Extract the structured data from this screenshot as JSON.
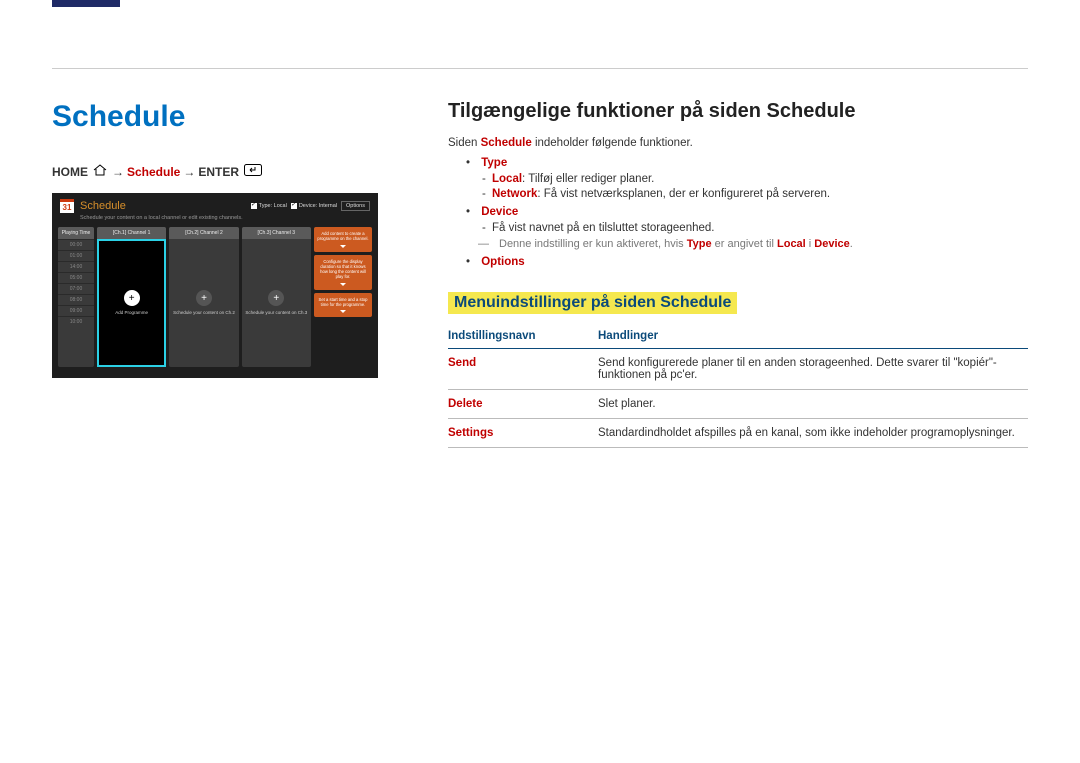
{
  "left": {
    "title": "Schedule",
    "breadcrumb": {
      "home": "HOME",
      "arrow": "→",
      "schedule": "Schedule",
      "enter": "ENTER"
    },
    "mock": {
      "calendar_day": "31",
      "title": "Schedule",
      "top_type": "Type: Local",
      "top_device": "Device: Internal",
      "top_options": "Options",
      "subtitle": "Schedule your content on a local channel or edit existing channels.",
      "times_header": "Playing Time",
      "times": [
        "00:00",
        "01:00",
        "14:00",
        "05:00",
        "07:00",
        "08:00",
        "09:00",
        "10:00"
      ],
      "ch1": {
        "header": "[Ch.1] Channel 1",
        "label": "Add Programme"
      },
      "ch2": {
        "header": "[Ch.2] Channel 2",
        "label": "Schedule your content on Ch.2"
      },
      "ch3": {
        "header": "[Ch.3] Channel 3",
        "label": "Schedule your content on Ch.3"
      },
      "tips": {
        "t1": "Add content to create a programme on the channel.",
        "t2": "Configure the display duration so that it knows how long the content will play for.",
        "t3": "Set a start time and a stop time for the programme."
      }
    }
  },
  "right": {
    "heading": "Tilgængelige funktioner på siden Schedule",
    "intro_pre": "Siden ",
    "intro_kw": "Schedule",
    "intro_post": " indeholder følgende funktioner.",
    "type": {
      "label": "Type",
      "local_kw": "Local",
      "local_text": ": Tilføj eller rediger planer.",
      "network_kw": "Network",
      "network_text": ": Få vist netværksplanen, der er konfigureret på serveren."
    },
    "device": {
      "label": "Device",
      "line1": "Få vist navnet på en tilsluttet storageenhed.",
      "note_pre": "Denne indstilling er kun aktiveret, hvis ",
      "note_type": "Type",
      "note_mid": " er angivet til ",
      "note_local": "Local",
      "note_sep": " i ",
      "note_device": "Device",
      "note_end": "."
    },
    "options_label": "Options",
    "menu_heading": "Menuindstillinger på siden Schedule",
    "table": {
      "col1": "Indstillingsnavn",
      "col2": "Handlinger",
      "rows": [
        {
          "name": "Send",
          "action": "Send konfigurerede planer til en anden storageenhed. Dette svarer til \"kopiér\"-funktionen på pc'er."
        },
        {
          "name": "Delete",
          "action": "Slet planer."
        },
        {
          "name": "Settings",
          "action": "Standardindholdet afspilles på en kanal, som ikke indeholder programoplysninger."
        }
      ]
    }
  }
}
